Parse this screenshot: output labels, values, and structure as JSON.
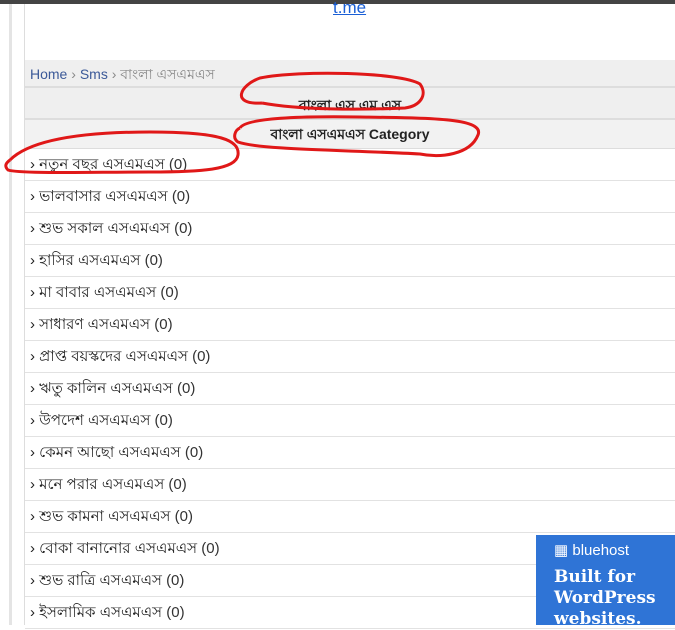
{
  "link_text": "t.me",
  "breadcrumb": {
    "home": "Home",
    "sms": "Sms",
    "current": "বাংলা এসএমএস",
    "sep": "›"
  },
  "title": "বাংলা এস.এম.এস",
  "category_header": "বাংলা এসএমএস Category",
  "items": [
    {
      "label": "নতুন বছর এসএমএস",
      "count": "(0)"
    },
    {
      "label": "ভালবাসার এসএমএস",
      "count": "(0)"
    },
    {
      "label": "শুভ সকাল এসএমএস",
      "count": "(0)"
    },
    {
      "label": "হাসির এসএমএস",
      "count": "(0)"
    },
    {
      "label": "মা বাবার এসএমএস",
      "count": "(0)"
    },
    {
      "label": "সাধারণ এসএমএস",
      "count": "(0)"
    },
    {
      "label": "প্রাপ্ত বয়স্কদের এসএমএস",
      "count": "(0)"
    },
    {
      "label": "ঋতু কালিন এসএমএস",
      "count": "(0)"
    },
    {
      "label": "উপদেশ এসএমএস",
      "count": "(0)"
    },
    {
      "label": "কেমন আছো এসএমএস",
      "count": "(0)"
    },
    {
      "label": "মনে পরার এসএমএস",
      "count": "(0)"
    },
    {
      "label": "শুভ কামনা এসএমএস",
      "count": "(0)"
    },
    {
      "label": "বোকা বানানোর এসএমএস",
      "count": "(0)"
    },
    {
      "label": "শুভ রাত্রি এসএমএস",
      "count": "(0)"
    },
    {
      "label": "ইসলামিক এসএমএস",
      "count": "(0)"
    }
  ],
  "ad": {
    "brand": "bluehost",
    "headline": "Built for WordPress websites.",
    "color": "#2f74d6"
  },
  "annotation_color": "#e01818"
}
